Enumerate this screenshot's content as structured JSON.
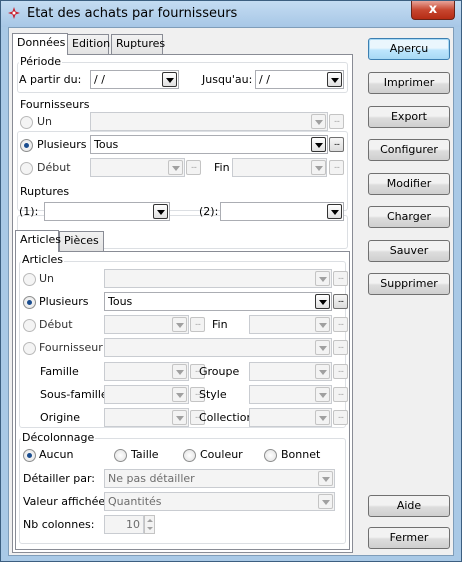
{
  "window": {
    "title": "Etat des achats par fournisseurs",
    "close": "x"
  },
  "tabs": [
    "Données",
    "Edition",
    "Ruptures"
  ],
  "periode": {
    "title": "Période",
    "from_label": "A partir du:",
    "from_value": " /  /",
    "to_label": "Jusqu'au:",
    "to_value": " /  /"
  },
  "fournisseurs": {
    "title": "Fournisseurs",
    "un": "Un",
    "plusieurs": "Plusieurs",
    "plusieurs_value": "Tous",
    "debut": "Début",
    "fin": "Fin"
  },
  "ruptures": {
    "title": "Ruptures",
    "r1": "(1):",
    "r2": "(2):"
  },
  "inner_tabs": [
    "Articles",
    "Pièces"
  ],
  "articles": {
    "title": "Articles",
    "un": "Un",
    "plusieurs": "Plusieurs",
    "plusieurs_value": "Tous",
    "debut": "Début",
    "fin": "Fin",
    "fournisseur": "Fournisseur",
    "famille": "Famille",
    "groupe": "Groupe",
    "sous_famille": "Sous-famille",
    "style": "Style",
    "origine": "Origine",
    "collection": "Collection"
  },
  "decolonnage": {
    "title": "Décolonnage",
    "aucun": "Aucun",
    "taille": "Taille",
    "couleur": "Couleur",
    "bonnet": "Bonnet",
    "detailler_label": "Détailler par:",
    "detailler_value": "Ne pas détailler",
    "valeur_label": "Valeur affichée:",
    "valeur_value": "Quantités",
    "nbcol_label": "Nb colonnes:",
    "nbcol_value": "10"
  },
  "buttons": {
    "apercu": "Aperçu",
    "imprimer": "Imprimer",
    "export": "Export",
    "configurer": "Configurer",
    "modifier": "Modifier",
    "charger": "Charger",
    "sauver": "Sauver",
    "supprimer": "Supprimer",
    "aide": "Aide",
    "fermer": "Fermer"
  },
  "icons": {
    "app": "app-icon",
    "close": "close-icon"
  }
}
